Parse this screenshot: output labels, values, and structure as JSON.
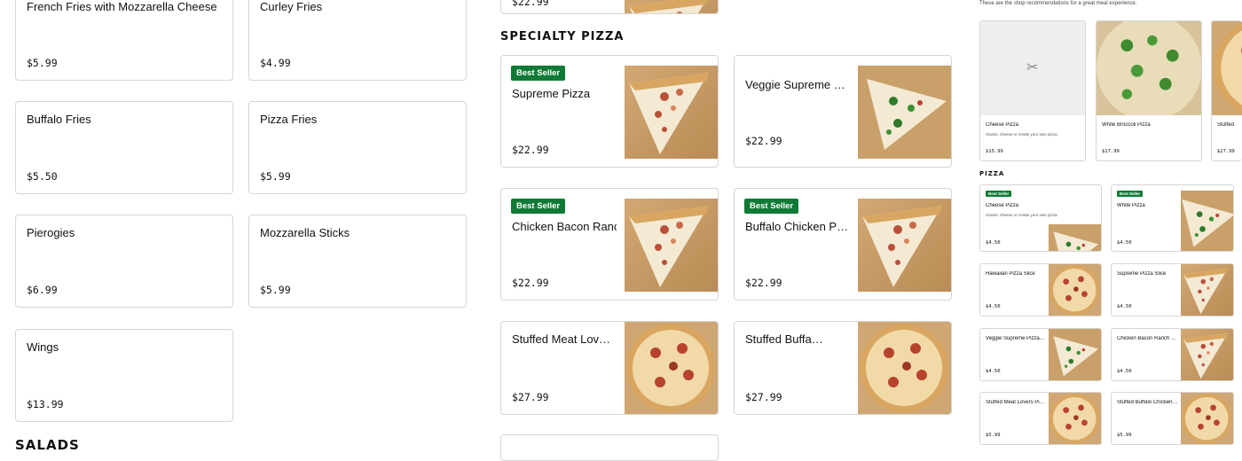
{
  "left_column": {
    "items": [
      {
        "name": "French Fries with Mozzarella Cheese",
        "price": "$5.99"
      },
      {
        "name": "Curley Fries",
        "price": "$4.99"
      },
      {
        "name": "Buffalo Fries",
        "price": "$5.50"
      },
      {
        "name": "Pizza Fries",
        "price": "$5.99"
      },
      {
        "name": "Pierogies",
        "price": "$6.99"
      },
      {
        "name": "Mozzarella Sticks",
        "price": "$5.99"
      },
      {
        "name": "Wings",
        "price": "$13.99"
      }
    ],
    "next_section_title": "SALADS"
  },
  "top_partial": {
    "price": "$22.99"
  },
  "specialty_pizza": {
    "title": "SPECIALTY PIZZA",
    "items": [
      {
        "name": "Supreme Pizza",
        "price": "$22.99",
        "badge": "Best Seller",
        "image_icon": "pizza-slice-image"
      },
      {
        "name": "Veggie Supreme Pizza",
        "price": "$22.99",
        "image_icon": "pizza-slice-image"
      },
      {
        "name": "Chicken Bacon Ranch Pizza",
        "price": "$22.99",
        "badge": "Best Seller",
        "image_icon": "pizza-slice-image"
      },
      {
        "name": "Buffalo Chicken Pizza",
        "price": "$22.99",
        "badge": "Best Seller",
        "image_icon": "pizza-slice-image"
      },
      {
        "name": "Stuffed Meat Lovers Pizza",
        "price": "$27.99",
        "image_icon": "whole-pizza-image"
      },
      {
        "name": "Stuffed Buffalo Chicken Pizza",
        "price": "$27.99",
        "image_icon": "whole-pizza-image"
      }
    ]
  },
  "right_panel": {
    "recommend_text": "These are the shop recommendations for a great meal experience.",
    "recommendations": [
      {
        "name": "Cheese Pizza",
        "desc": "Classic cheese or create your own pizza.",
        "price": "$15.99",
        "image_icon": "utensils-placeholder-icon"
      },
      {
        "name": "White Broccoli Pizza",
        "price": "$17.99",
        "image_icon": "broccoli-pizza-image"
      },
      {
        "name": "Stuffed",
        "price": "$27.99",
        "image_icon": "pizza-image"
      }
    ],
    "pizza_title": "PIZZA",
    "pizza_items": [
      {
        "name": "Cheese Pizza",
        "desc": "Classic cheese or create your own pizza.",
        "price": "$4.50",
        "badge": "Best Seller"
      },
      {
        "name": "White Pizza",
        "price": "$4.50",
        "badge": "Best Seller"
      },
      {
        "name": "Hawaiian Pizza Slice",
        "price": "$4.50"
      },
      {
        "name": "Supreme Pizza Slice",
        "price": "$4.50"
      },
      {
        "name": "Veggie Supreme Pizza Slice",
        "price": "$4.50"
      },
      {
        "name": "Chicken Bacon Ranch Pizza Slice",
        "price": "$4.50"
      },
      {
        "name": "Stuffed Meat Lovers Pizza Slice",
        "price": "$5.99"
      },
      {
        "name": "Stuffed Buffalo Chicken Pizza Slice",
        "price": "$5.99"
      }
    ]
  },
  "colors": {
    "badge": "#0e7a35",
    "border": "#d6d6d6",
    "board": "#c9a06a"
  }
}
